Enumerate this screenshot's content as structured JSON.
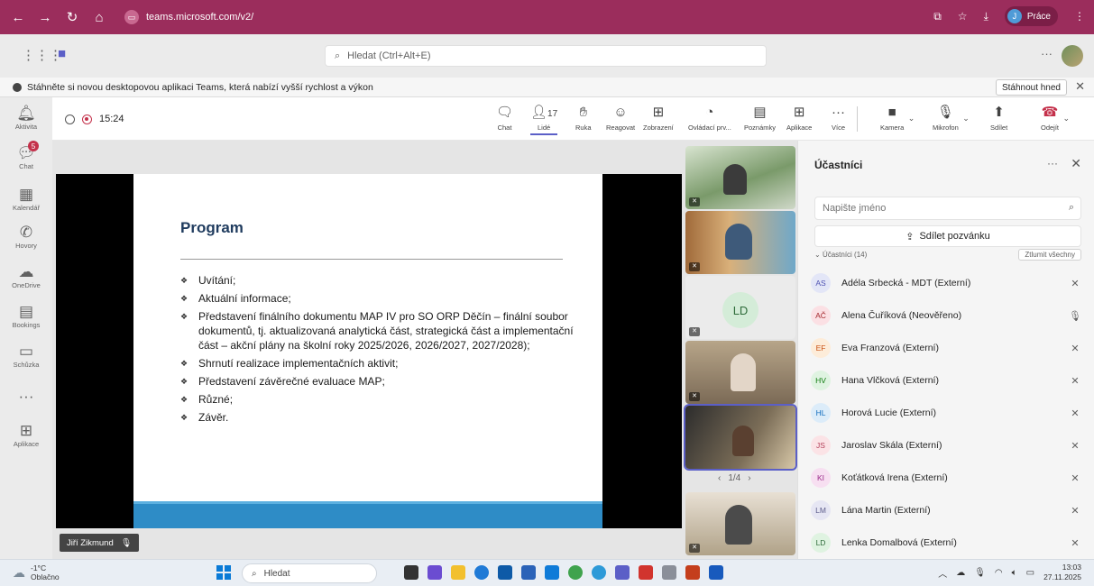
{
  "browser": {
    "url": "teams.microsoft.com/v2/",
    "profile_label": "Práce",
    "profile_initial": "J"
  },
  "teams": {
    "search_placeholder": "Hledat (Ctrl+Alt+E)"
  },
  "banner": {
    "text": "Stáhněte si novou desktopovou aplikaci Teams, která nabízí vyšší rychlost a výkon",
    "button": "Stáhnout hned"
  },
  "rail": [
    {
      "label": "Aktivita",
      "icon": "bell-icon"
    },
    {
      "label": "Chat",
      "icon": "chat-icon"
    },
    {
      "label": "Kalendář",
      "icon": "calendar-icon"
    },
    {
      "label": "Hovory",
      "icon": "phone-icon"
    },
    {
      "label": "OneDrive",
      "icon": "cloud-icon"
    },
    {
      "label": "Bookings",
      "icon": "bookings-icon"
    },
    {
      "label": "Schůzka",
      "icon": "camera-icon"
    },
    {
      "label": "Aplikace",
      "icon": "plus-icon"
    }
  ],
  "chat_badge": "5",
  "meeting": {
    "time": "15:24",
    "people_count": "17",
    "toolbar": [
      {
        "label": "Chat"
      },
      {
        "label": "Lidé"
      },
      {
        "label": "Ruka"
      },
      {
        "label": "Reagovat"
      },
      {
        "label": "Zobrazení"
      },
      {
        "label": "Ovládací prv..."
      },
      {
        "label": "Poznámky"
      },
      {
        "label": "Aplikace"
      },
      {
        "label": "Více"
      },
      {
        "label": "Kamera"
      },
      {
        "label": "Mikrofon"
      },
      {
        "label": "Sdílet"
      },
      {
        "label": "Odejít"
      }
    ]
  },
  "slide": {
    "title": "Program",
    "items": [
      "Uvítání;",
      "Aktuální informace;",
      "Představení finálního dokumentu MAP IV pro SO ORP Děčín – finální soubor dokumentů, tj. aktualizovaná analytická část, strategická část a implementační část – akční plány na školní roky 2025/2026, 2026/2027, 2027/2028);",
      "Shrnutí realizace implementačních aktivit;",
      "Představení závěrečné evaluace MAP;",
      "Různé;",
      "Závěr."
    ],
    "presenter": "Jiří Zikmund"
  },
  "tiles": {
    "initials": "LD",
    "pager": "1/4"
  },
  "participants": {
    "title": "Účastníci",
    "search_placeholder": "Napište jméno",
    "invite": "Sdílet pozvánku",
    "section": "Účastníci (14)",
    "mute_all": "Ztlumit všechny",
    "list": [
      {
        "initials": "AS",
        "name": "Adéla Srbecká - MDT (Externí)",
        "bg": "#e3e6f7",
        "fg": "#4f52b2",
        "mic": "muted"
      },
      {
        "initials": "AČ",
        "name": "Alena Čuříková (Neověřeno)",
        "bg": "#fbe0e4",
        "fg": "#a4262c",
        "mic": "on"
      },
      {
        "initials": "EF",
        "name": "Eva Franzová (Externí)",
        "bg": "#fdecd9",
        "fg": "#ca5010",
        "mic": "muted"
      },
      {
        "initials": "HV",
        "name": "Hana Vlčková (Externí)",
        "bg": "#dff3e1",
        "fg": "#107c10",
        "mic": "muted"
      },
      {
        "initials": "HL",
        "name": "Horová Lucie (Externí)",
        "bg": "#dcecf9",
        "fg": "#0f6cbd",
        "mic": "muted"
      },
      {
        "initials": "JS",
        "name": "Jaroslav Skála (Externí)",
        "bg": "#fbe3e6",
        "fg": "#b4405a",
        "mic": "muted"
      },
      {
        "initials": "KI",
        "name": "Koťátková Irena (Externí)",
        "bg": "#f7dff1",
        "fg": "#9b2a8a",
        "mic": "muted"
      },
      {
        "initials": "LM",
        "name": "Lána Martin (Externí)",
        "bg": "#e6e6f3",
        "fg": "#5c5c8a",
        "mic": "muted"
      },
      {
        "initials": "LD",
        "name": "Lenka Domalbová (Externí)",
        "bg": "#dff3e1",
        "fg": "#2e6b3a",
        "mic": "muted"
      }
    ]
  },
  "taskbar": {
    "temp": "-1°C",
    "weather": "Oblačno",
    "search": "Hledat",
    "time": "13:03",
    "date": "27.11.2025"
  }
}
